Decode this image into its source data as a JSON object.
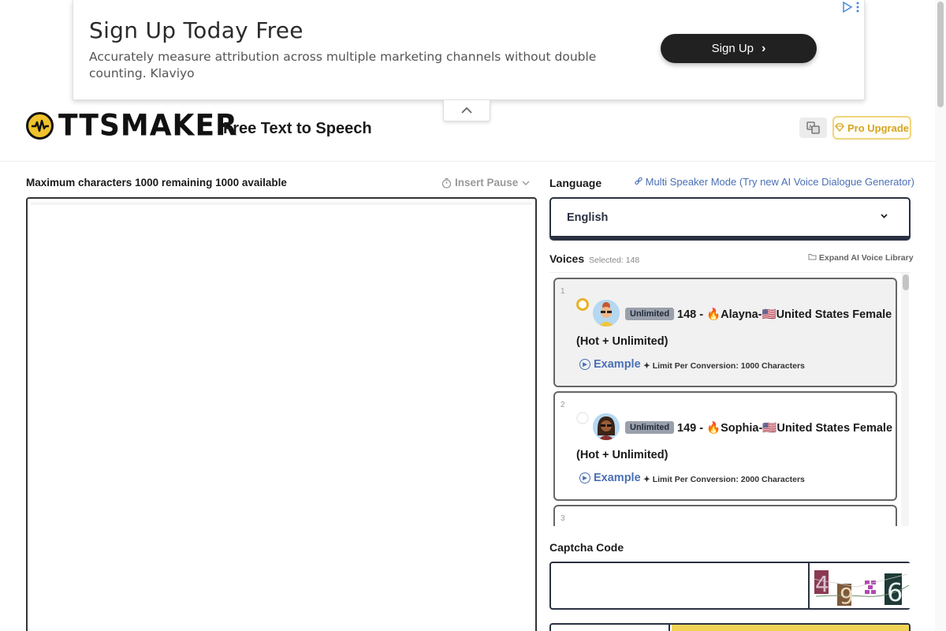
{
  "ad": {
    "title": "Sign Up Today Free",
    "description": "Accurately measure attribution across multiple marketing channels without double counting. Klaviyo",
    "button_label": "Sign Up"
  },
  "header": {
    "logo_text": "TTSMAKER",
    "subtitle": "Free Text to Speech",
    "pro_label": "Pro Upgrade"
  },
  "editor": {
    "char_info": "Maximum characters 1000 remaining 1000 available",
    "insert_pause": "Insert Pause",
    "text": ""
  },
  "language": {
    "label": "Language",
    "multi_speaker_link": "Multi Speaker Mode (Try new AI Voice Dialogue Generator)",
    "selected": "English"
  },
  "voices": {
    "label": "Voices",
    "selected_info": "Selected: 148",
    "expand_label": "Expand AI Voice Library",
    "items": [
      {
        "num": "1",
        "badge": "Unlimited",
        "name": "148 - 🔥Alayna-🇺🇸United States Female",
        "name2": "(Hot + Unlimited)",
        "example": "Example",
        "limit": "Limit Per Conversion: 1000 Characters",
        "selected": true
      },
      {
        "num": "2",
        "badge": "Unlimited",
        "name": "149 - 🔥Sophia-🇺🇸United States Female",
        "name2": "(Hot + Unlimited)",
        "example": "Example",
        "limit": "Limit Per Conversion: 2000 Characters",
        "selected": false
      },
      {
        "num": "3"
      }
    ]
  },
  "captcha": {
    "label": "Captcha Code",
    "value": "",
    "image_text": "4986"
  },
  "colors": {
    "accent_yellow": "#f0c22b",
    "link_blue": "#4a6fb5",
    "dark_border": "#2a3142"
  }
}
